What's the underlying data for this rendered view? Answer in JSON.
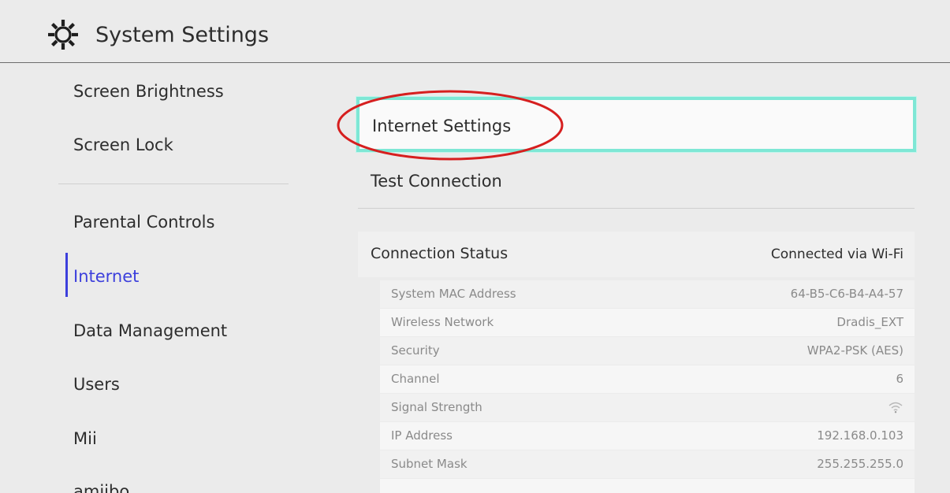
{
  "header": {
    "title": "System Settings",
    "icon": "gear-icon"
  },
  "sidebar": {
    "items": [
      {
        "label": "Screen Brightness",
        "selected": false
      },
      {
        "label": "Screen Lock",
        "selected": false
      },
      {
        "label": "Parental Controls",
        "selected": false
      },
      {
        "label": "Internet",
        "selected": true
      },
      {
        "label": "Data Management",
        "selected": false
      },
      {
        "label": "Users",
        "selected": false
      },
      {
        "label": "Mii",
        "selected": false
      },
      {
        "label": "amiibo",
        "selected": false
      }
    ]
  },
  "main": {
    "internet_settings_label": "Internet Settings",
    "test_connection_label": "Test Connection",
    "connection_status": {
      "label": "Connection Status",
      "value": "Connected via Wi-Fi"
    },
    "details": [
      {
        "label": "System MAC Address",
        "value": "64-B5-C6-B4-A4-57"
      },
      {
        "label": "Wireless Network",
        "value": "Dradis_EXT"
      },
      {
        "label": "Security",
        "value": "WPA2-PSK (AES)"
      },
      {
        "label": "Channel",
        "value": "6"
      },
      {
        "label": "Signal Strength",
        "value": "",
        "icon": "wifi-signal-icon"
      },
      {
        "label": "IP Address",
        "value": "192.168.0.103"
      },
      {
        "label": "Subnet Mask",
        "value": "255.255.255.0"
      }
    ]
  },
  "colors": {
    "background": "#ebebeb",
    "accent_selected": "#3c3fdc",
    "focus_border": "#7ee7d5",
    "annotation": "#d61f1f",
    "text": "#2d2d2d",
    "muted_text": "#8a8a8a"
  }
}
